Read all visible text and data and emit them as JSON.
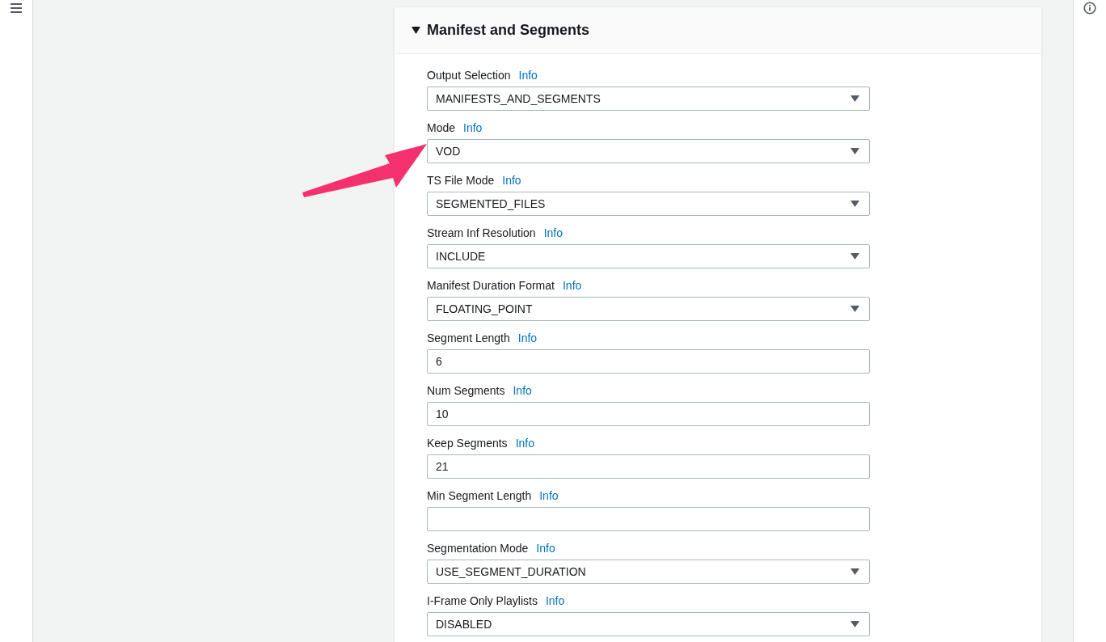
{
  "section": {
    "title": "Manifest and Segments",
    "expanded": true
  },
  "fields": [
    {
      "label": "Output Selection",
      "info": "Info",
      "kind": "select",
      "value": "MANIFESTS_AND_SEGMENTS"
    },
    {
      "label": "Mode",
      "info": "Info",
      "kind": "select",
      "value": "VOD"
    },
    {
      "label": "TS File Mode",
      "info": "Info",
      "kind": "select",
      "value": "SEGMENTED_FILES"
    },
    {
      "label": "Stream Inf Resolution",
      "info": "Info",
      "kind": "select",
      "value": "INCLUDE"
    },
    {
      "label": "Manifest Duration Format",
      "info": "Info",
      "kind": "select",
      "value": "FLOATING_POINT"
    },
    {
      "label": "Segment Length",
      "info": "Info",
      "kind": "text",
      "value": "6"
    },
    {
      "label": "Num Segments",
      "info": "Info",
      "kind": "text",
      "value": "10"
    },
    {
      "label": "Keep Segments",
      "info": "Info",
      "kind": "text",
      "value": "21"
    },
    {
      "label": "Min Segment Length",
      "info": "Info",
      "kind": "text"
    },
    {
      "label": "Segmentation Mode",
      "info": "Info",
      "kind": "select",
      "value": "USE_SEGMENT_DURATION"
    },
    {
      "label": "I-Frame Only Playlists",
      "info": "Info",
      "kind": "select",
      "value": "DISABLED"
    }
  ]
}
